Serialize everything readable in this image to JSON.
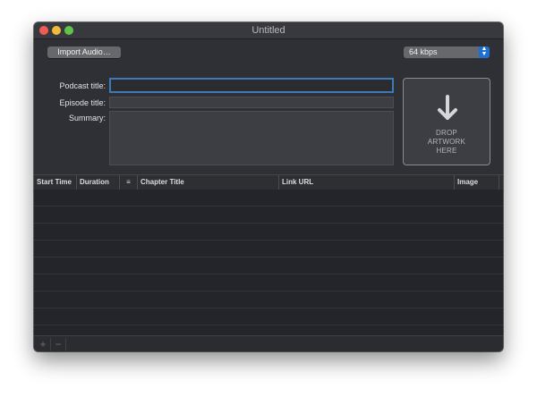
{
  "window": {
    "title": "Untitled"
  },
  "toolbar": {
    "import_label": "Import Audio…",
    "bitrate_value": "64 kbps",
    "bitrate_arrows": {
      "up": "▲",
      "down": "▼"
    }
  },
  "form": {
    "podcast_title_label": "Podcast title:",
    "podcast_title_value": "",
    "episode_title_label": "Episode title:",
    "episode_title_value": "",
    "summary_label": "Summary:",
    "summary_value": ""
  },
  "artwork": {
    "line1": "DROP",
    "line2": "ARTWORK",
    "line3": "HERE",
    "icon": "down-arrow-icon"
  },
  "table": {
    "columns": [
      "Start Time",
      "Duration",
      "≡",
      "Chapter Title",
      "Link URL",
      "Image"
    ],
    "rows": []
  },
  "footer": {
    "add_label": "+",
    "remove_label": "−"
  },
  "colors": {
    "accent": "#1f6fd3",
    "focus_ring": "#3c7ab8"
  }
}
